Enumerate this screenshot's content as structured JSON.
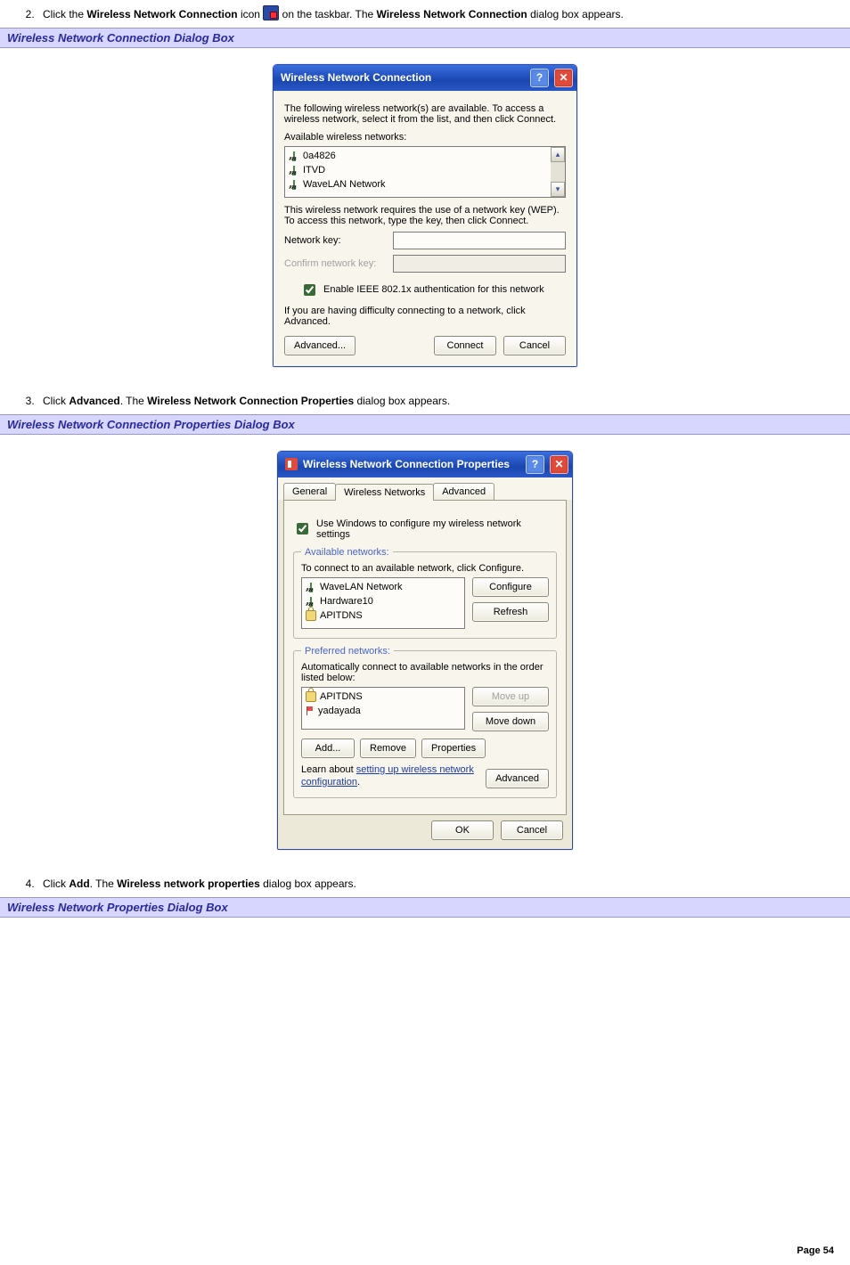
{
  "step2": {
    "number": "2.",
    "pre": "Click the ",
    "bold1": "Wireless Network Connection",
    "mid1": " icon ",
    "mid2": " on the taskbar. The ",
    "bold2": "Wireless Network Connection",
    "post": " dialog box appears."
  },
  "section1": "Wireless Network Connection Dialog Box",
  "section2": "Wireless Network Connection Properties Dialog Box",
  "section3": "Wireless Network Properties Dialog Box",
  "step3": {
    "number": "3.",
    "pre": "Click ",
    "bold1": "Advanced",
    "mid": ". The ",
    "bold2": "Wireless Network Connection Properties",
    "post": " dialog box appears."
  },
  "step4": {
    "number": "4.",
    "pre": "Click ",
    "bold1": "Add",
    "mid": ". The ",
    "bold2": "Wireless network properties",
    "post": " dialog box appears."
  },
  "dlg1": {
    "title": "Wireless Network Connection",
    "intro": "The following wireless network(s) are available. To access a wireless network, select it from the list, and then click Connect.",
    "avail_label": "Available wireless networks:",
    "networks": [
      "0a4826",
      "ITVD",
      "WaveLAN Network"
    ],
    "req_text": "This wireless network requires the use of a network key (WEP). To access this network, type the key, then click Connect.",
    "netkey_label": "Network key:",
    "confirm_label": "Confirm network key:",
    "enable_8021x": "Enable IEEE 802.1x authentication for this network",
    "difficulty": "If you are having difficulty connecting to a network, click Advanced.",
    "advanced_btn": "Advanced...",
    "connect_btn": "Connect",
    "cancel_btn": "Cancel",
    "help": "?",
    "close": "✕",
    "scroll_up": "▴",
    "scroll_down": "▾"
  },
  "dlg2": {
    "title": "Wireless Network Connection Properties",
    "tabs": {
      "general": "General",
      "wireless": "Wireless Networks",
      "advanced": "Advanced"
    },
    "use_windows": "Use Windows to configure my wireless network settings",
    "avail_legend": "Available networks:",
    "avail_hint": "To connect to an available network, click Configure.",
    "avail_items": [
      "WaveLAN Network",
      "Hardware10",
      "APITDNS"
    ],
    "configure_btn": "Configure",
    "refresh_btn": "Refresh",
    "pref_legend": "Preferred networks:",
    "pref_hint": "Automatically connect to available networks in the order listed below:",
    "pref_items": [
      "APITDNS",
      "yadayada"
    ],
    "moveup_btn": "Move up",
    "movedown_btn": "Move down",
    "add_btn": "Add...",
    "remove_btn": "Remove",
    "properties_btn": "Properties",
    "learn_pre": "Learn about ",
    "learn_link": "setting up wireless network configuration",
    "learn_post": ".",
    "advanced_btn": "Advanced",
    "ok_btn": "OK",
    "cancel_btn": "Cancel",
    "help": "?",
    "close": "✕"
  },
  "page_number": "Page 54"
}
